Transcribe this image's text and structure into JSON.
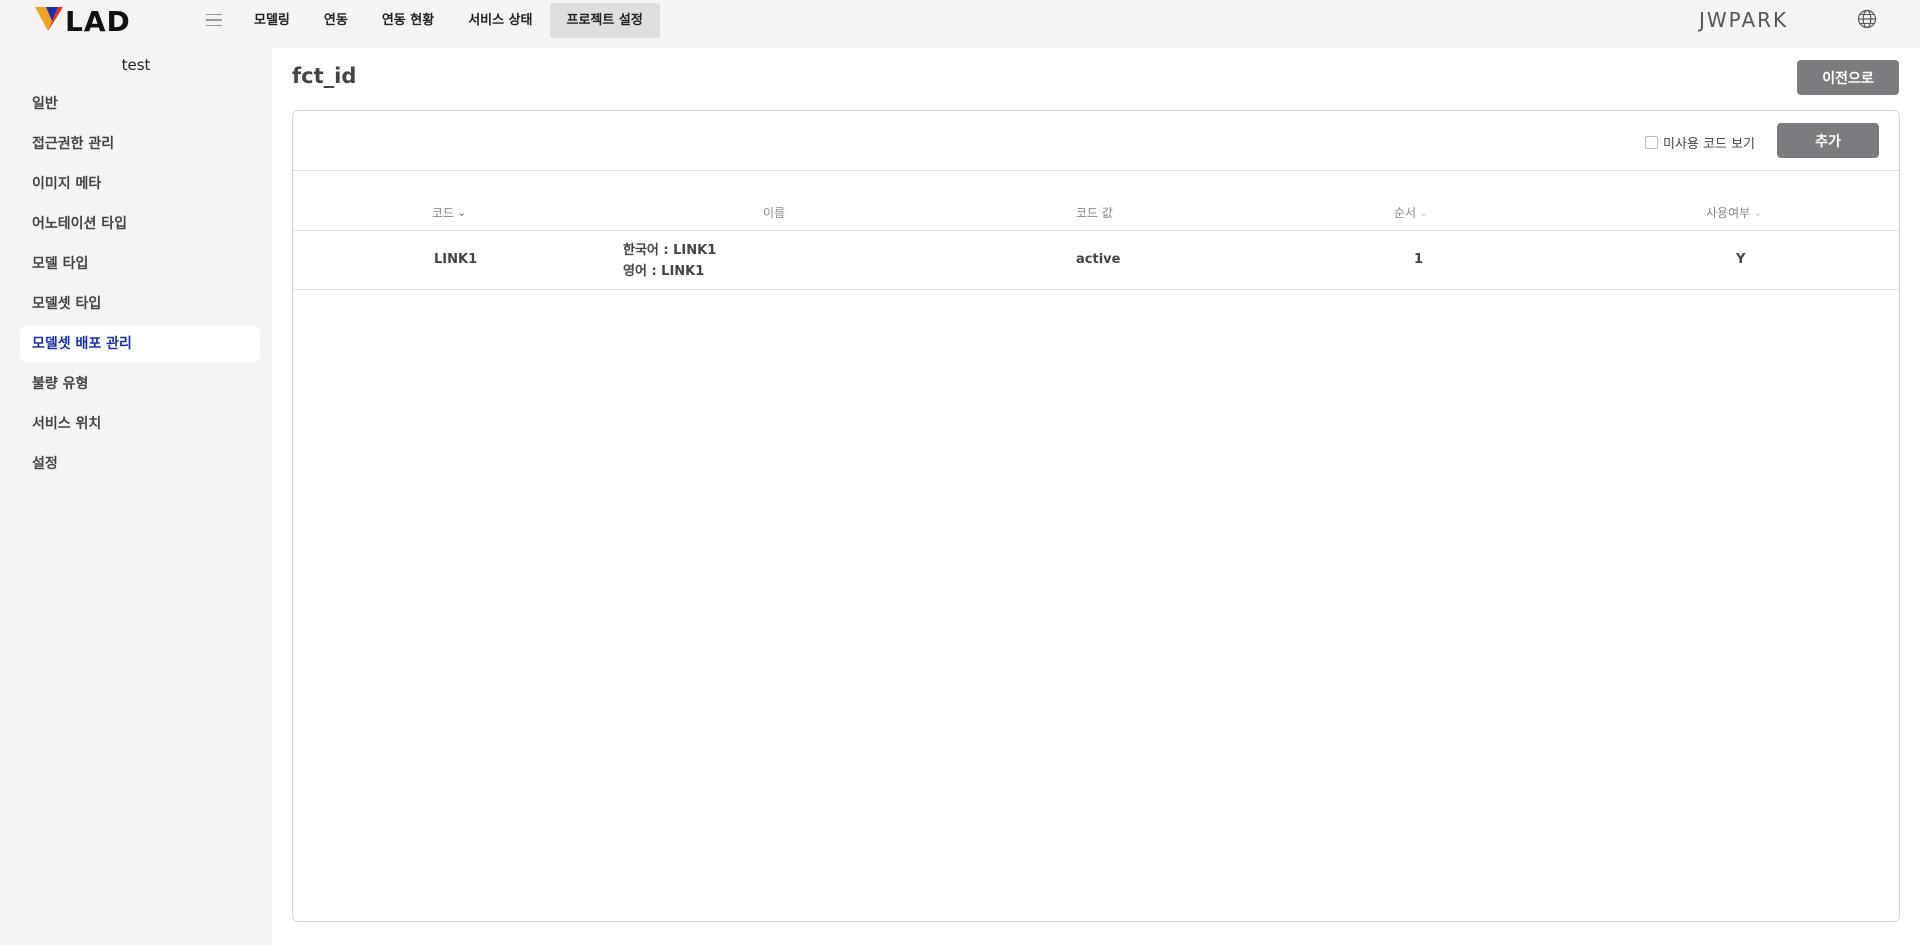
{
  "brand": {
    "logo_text": "LAD",
    "accent_colors": [
      "#f2a21a",
      "#e5321e",
      "#1a2fb0"
    ]
  },
  "topnav": {
    "items": [
      {
        "label": "모델링"
      },
      {
        "label": "연동"
      },
      {
        "label": "연동 현황"
      },
      {
        "label": "서비스 상태"
      },
      {
        "label": "프로젝트 설정",
        "active": true
      }
    ]
  },
  "user": {
    "name": "JWPARK"
  },
  "sidebar": {
    "project": "test",
    "items": [
      {
        "label": "일반"
      },
      {
        "label": "접근권한 관리"
      },
      {
        "label": "이미지 메타"
      },
      {
        "label": "어노테이션 타입"
      },
      {
        "label": "모델 타입"
      },
      {
        "label": "모델셋 타입"
      },
      {
        "label": "모델셋 배포 관리",
        "active": true
      },
      {
        "label": "불량 유형"
      },
      {
        "label": "서비스 위치"
      },
      {
        "label": "설정"
      }
    ]
  },
  "main": {
    "title": "fct_id",
    "back_label": "이전으로",
    "unused_label": "미사용 코드 보기",
    "add_label": "추가",
    "columns": {
      "code": "코드",
      "name": "이름",
      "value": "코드 값",
      "order": "순서",
      "use": "사용여부"
    },
    "rows": [
      {
        "code": "LINK1",
        "name_ko": "한국어 : LINK1",
        "name_en": "영어 : LINK1",
        "value": "active",
        "order": "1",
        "use": "Y"
      }
    ]
  }
}
